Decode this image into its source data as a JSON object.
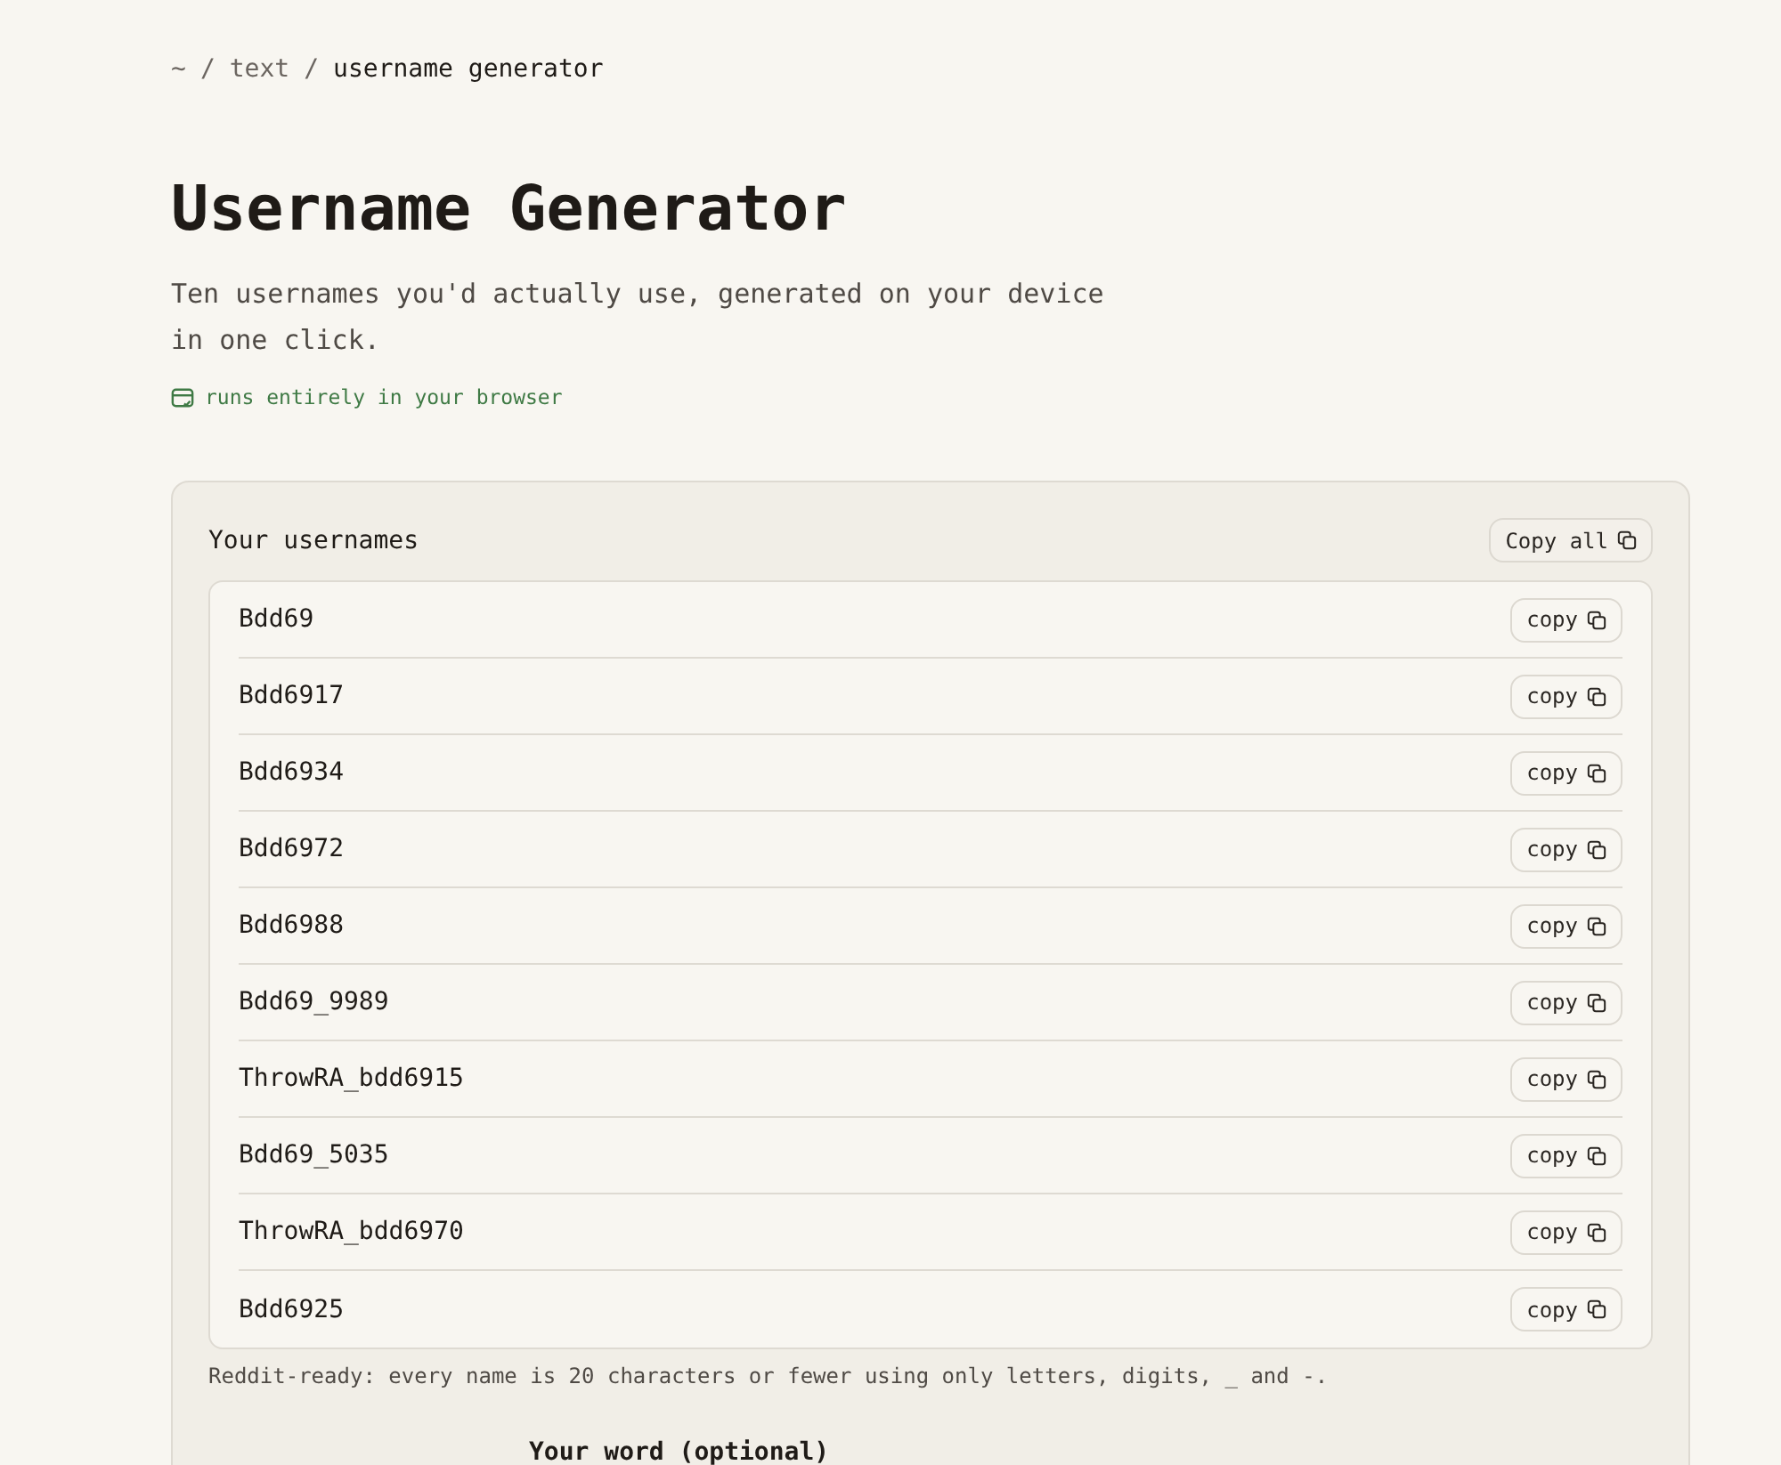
{
  "breadcrumb": [
    {
      "kind": "link",
      "label": "~"
    },
    {
      "kind": "sep",
      "label": "/"
    },
    {
      "kind": "link",
      "label": "text"
    },
    {
      "kind": "sep",
      "label": "/"
    },
    {
      "kind": "current",
      "label": "username generator"
    }
  ],
  "title": "Username Generator",
  "subtitle": "Ten usernames you'd actually use, generated on your device in one click.",
  "privacy_note": "runs entirely in your browser",
  "results": {
    "heading": "Your usernames",
    "copy_all": "Copy all",
    "usernames": [
      {
        "name": "Bdd69",
        "copy": "copy"
      },
      {
        "name": "Bdd6917",
        "copy": "copy"
      },
      {
        "name": "Bdd6934",
        "copy": "copy"
      },
      {
        "name": "Bdd6972",
        "copy": "copy"
      },
      {
        "name": "Bdd6988",
        "copy": "copy"
      },
      {
        "name": "Bdd69_9989",
        "copy": "copy"
      },
      {
        "name": "ThrowRA_bdd6915",
        "copy": "copy"
      },
      {
        "name": "Bdd69_5035",
        "copy": "copy"
      },
      {
        "name": "ThrowRA_bdd6970",
        "copy": "copy"
      },
      {
        "name": "Bdd6925",
        "copy": "copy"
      }
    ],
    "note": "Reddit-ready: every name is 20 characters or fewer using only letters, digits, _ and -."
  },
  "word_label": "Your word (optional)"
}
